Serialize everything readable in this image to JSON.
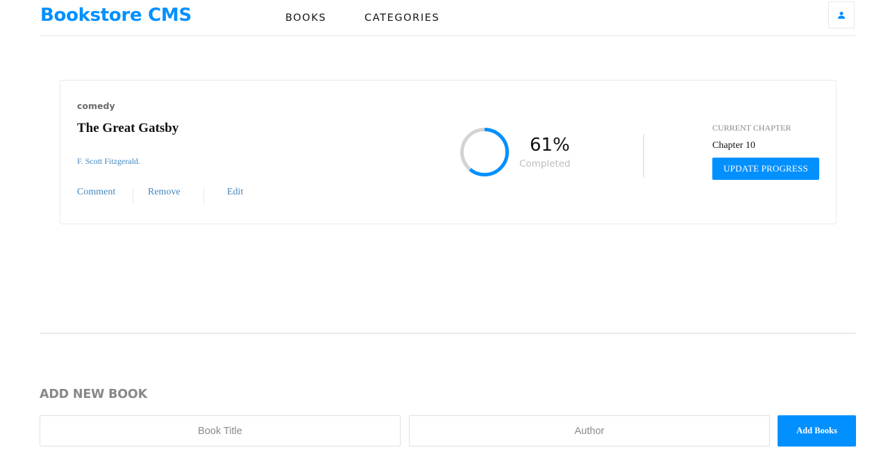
{
  "header": {
    "logo": "Bookstore CMS",
    "nav": [
      {
        "label": "BOOKS"
      },
      {
        "label": "CATEGORIES"
      }
    ],
    "user_icon": "user-icon"
  },
  "book": {
    "category": "comedy",
    "title": "The Great Gatsby",
    "author": "F. Scott Fitzgerald.",
    "actions": {
      "comment": "Comment",
      "remove": "Remove",
      "edit": "Edit"
    },
    "progress": {
      "percent_value": 61,
      "percent_label": "61%",
      "completed_label": "Completed"
    },
    "current_chapter_label": "CURRENT CHAPTER",
    "current_chapter": "Chapter 10",
    "update_button": "UPDATE PROGRESS"
  },
  "form": {
    "heading": "ADD NEW BOOK",
    "title_placeholder": "Book Title",
    "title_value": "",
    "author_placeholder": "Author",
    "author_value": "",
    "submit_label": "Add Books"
  },
  "colors": {
    "accent": "#0290ff",
    "ring_track": "#d3d3d3",
    "link": "#4386bf",
    "muted": "#888888"
  }
}
